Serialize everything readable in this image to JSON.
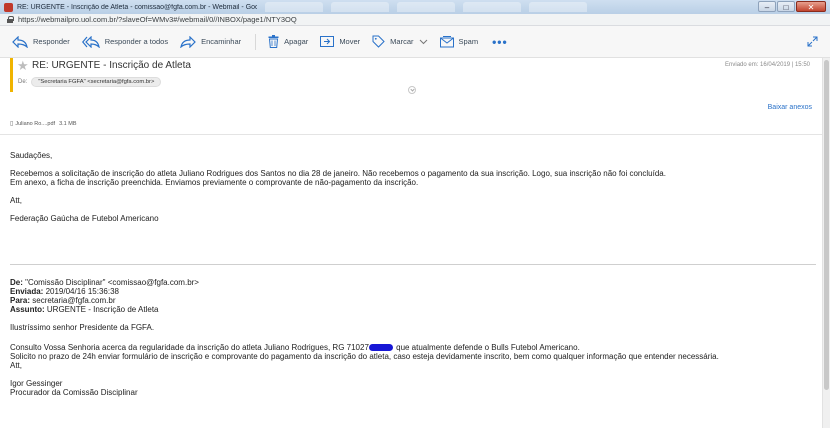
{
  "window": {
    "title": "RE: URGENTE - Inscrição de Atleta - comissao@fgfa.com.br - Webmail - Google Chrome",
    "minimize_glyph": "–",
    "maximize_glyph": "□",
    "close_glyph": "✕"
  },
  "address_bar": {
    "url": "https://webmailpro.uol.com.br/?slaveOf=WMv3#/webmail/0//INBOX/page1/NTY3OQ"
  },
  "toolbar": {
    "reply": "Responder",
    "reply_all": "Responder a todos",
    "forward": "Encaminhar",
    "delete": "Apagar",
    "move": "Mover",
    "mark": "Marcar",
    "spam": "Spam",
    "more": "•••",
    "accent_color": "#2a72c9"
  },
  "message": {
    "subject": "RE: URGENTE - Inscrição de Atleta",
    "sent_date": "Enviado em: 16/04/2019 | 15:50",
    "from_label": "De:",
    "from": "\"Secretaria FGFA\" <secretaria@fgfa.com.br>",
    "header_accent": "#f0b400"
  },
  "attachments": {
    "download_all": "Baixar anexos",
    "items": [
      {
        "name": "Juliano Ro....pdf",
        "size": "3.1 MB"
      }
    ]
  },
  "body": {
    "lines": [
      "Saudações,",
      "Recebemos a solicitação de inscrição do atleta Juliano Rodrigues dos Santos no dia 28 de janeiro. Não recebemos o pagamento da sua inscrição. Logo, sua inscrição não foi concluída.",
      "Em anexo, a ficha de inscrição preenchida. Enviamos previamente o comprovante de não-pagamento da inscrição.",
      "Att,",
      "Federação Gaúcha de Futebol Americano"
    ]
  },
  "quoted": {
    "from_label": "De:",
    "from": " \"Comissão Disciplinar\" <comissao@fgfa.com.br>",
    "sent_label": "Enviada:",
    "sent": " 2019/04/16 15:36:38",
    "to_label": "Para:",
    "to": " secretaria@fgfa.com.br",
    "subject_label": "Assunto:",
    "subject": " URGENTE - Inscrição de Atleta",
    "greeting": "Ilustríssimo senhor Presidente da FGFA.",
    "line1_before": "Consulto Vossa Senhoria acerca da regularidade da inscrição do atleta Juliano Rodrigues, RG 71027",
    "line1_after": " que atualmente defende o Bulls Futebol Americano.",
    "line2": "Solicito no prazo de 24h enviar formulário de inscrição e comprovante do pagamento da inscrição do atleta, caso esteja devidamente inscrito, bem como qualquer informação que entender necessária.",
    "closing": "Att,",
    "signature_name": "Igor Gessinger",
    "signature_title": "Procurador da Comissão Disciplinar"
  }
}
